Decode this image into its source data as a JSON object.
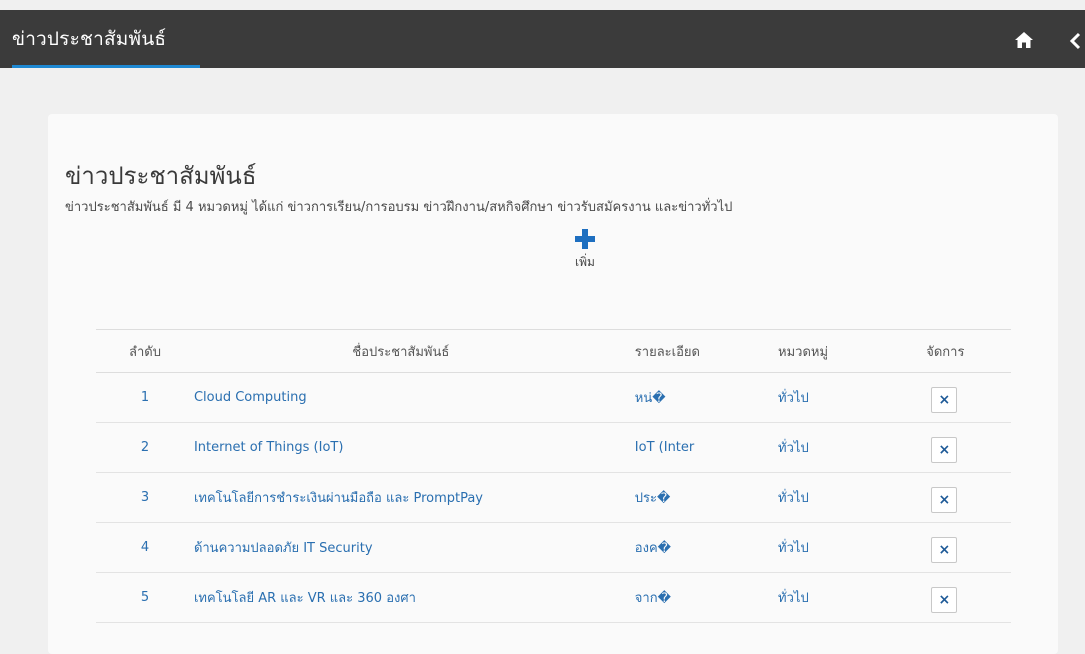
{
  "header": {
    "title": "ข่าวประชาสัมพันธ์",
    "home_icon": "home-icon",
    "back_icon": "chevron-left-icon"
  },
  "page": {
    "title": "ข่าวประชาสัมพันธ์",
    "description": "ข่าวประชาสัมพันธ์ มี 4 หมวดหมู่ ได้แก่ ข่าวการเรียน/การอบรม ข่าวฝึกงาน/สหกิจศึกษา ข่าวรับสมัครงาน และข่าวทั่วไป",
    "add_label": "เพิ่ม"
  },
  "table": {
    "headers": {
      "no": "ลำดับ",
      "name": "ชื่อประชาสัมพันธ์",
      "detail": "รายละเอียด",
      "category": "หมวดหมู่",
      "action": "จัดการ"
    },
    "rows": [
      {
        "no": "1",
        "name": "Cloud Computing",
        "detail": "หน่�",
        "category": "ทั่วไป",
        "action": "×"
      },
      {
        "no": "2",
        "name": "Internet of Things (IoT)",
        "detail": "IoT (Inter",
        "category": "ทั่วไป",
        "action": "×"
      },
      {
        "no": "3",
        "name": "เทคโนโลยีการชำระเงินผ่านมือถือ และ PromptPay",
        "detail": "ประ�",
        "category": "ทั่วไป",
        "action": "×"
      },
      {
        "no": "4",
        "name": "ด้านความปลอดภัย IT Security",
        "detail": "องค�",
        "category": "ทั่วไป",
        "action": "×"
      },
      {
        "no": "5",
        "name": "เทคโนโลยี AR และ VR และ 360 องศา",
        "detail": "จาก�",
        "category": "ทั่วไป",
        "action": "×"
      }
    ]
  },
  "colors": {
    "topbar": "#3b3b3b",
    "accent": "#1e88d2",
    "link": "#2a6fb0"
  }
}
